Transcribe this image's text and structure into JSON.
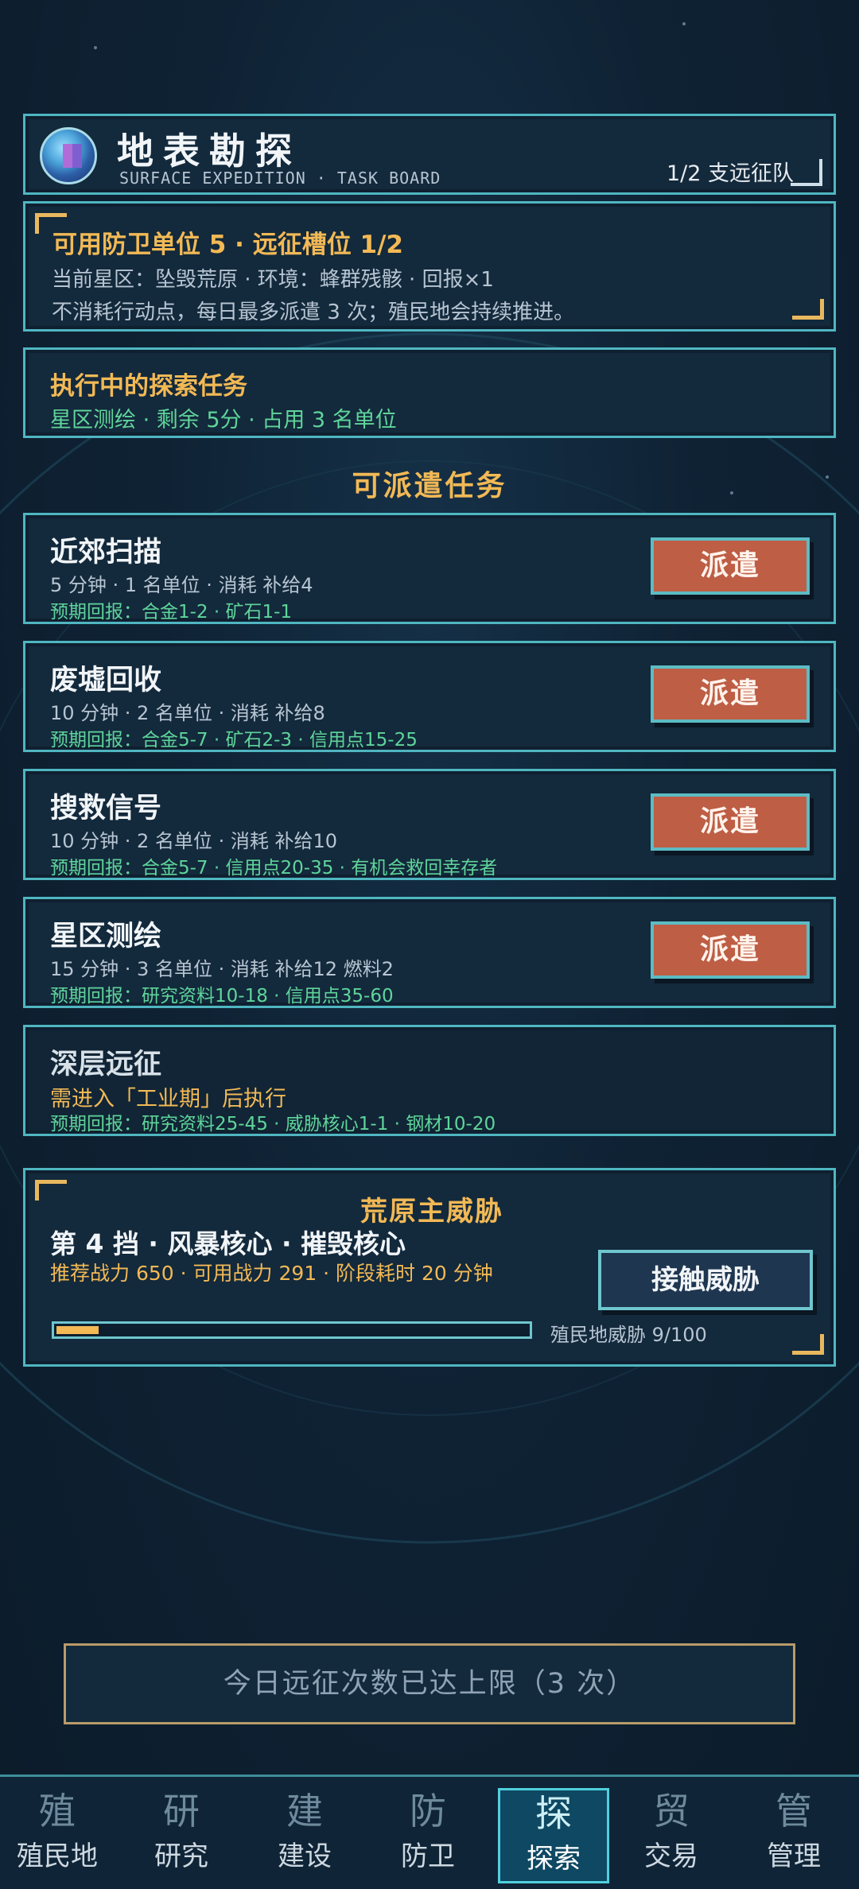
{
  "header": {
    "title": "地表勘探",
    "subtitle": "SURFACE EXPEDITION · TASK BOARD",
    "squad_count": "1/2 支远征队"
  },
  "info": {
    "line1": "可用防卫单位 5 · 远征槽位 1/2",
    "line2": "当前星区：坠毁荒原 · 环境：蜂群残骸 · 回报×1",
    "line3": "不消耗行动点，每日最多派遣 3 次；殖民地会持续推进。"
  },
  "running": {
    "title": "执行中的探索任务",
    "detail": "星区测绘 · 剩余 5分 · 占用 3 名单位"
  },
  "section_title": "可派遣任务",
  "tasks": [
    {
      "name": "近郊扫描",
      "meta": "5 分钟 · 1 名单位 · 消耗 补给4",
      "reward": "预期回报：合金1-2 · 矿石1-1",
      "button": "派遣"
    },
    {
      "name": "废墟回收",
      "meta": "10 分钟 · 2 名单位 · 消耗 补给8",
      "reward": "预期回报：合金5-7 · 矿石2-3 · 信用点15-25",
      "button": "派遣"
    },
    {
      "name": "搜救信号",
      "meta": "10 分钟 · 2 名单位 · 消耗 补给10",
      "reward": "预期回报：合金5-7 · 信用点20-35 · 有机会救回幸存者",
      "button": "派遣"
    },
    {
      "name": "星区测绘",
      "meta": "15 分钟 · 3 名单位 · 消耗 补给12 燃料2",
      "reward": "预期回报：研究资料10-18 · 信用点35-60",
      "button": "派遣"
    },
    {
      "name": "深层远征",
      "requirement": "需进入「工业期」后执行",
      "reward": "预期回报：研究资料25-45 · 威胁核心1-1 · 钢材10-20"
    }
  ],
  "boss": {
    "title": "荒原主威胁",
    "tier": "第 4 挡 · 风暴核心 · 摧毁核心",
    "stats": "推荐战力 650 · 可用战力 291 · 阶段耗时 20 分钟",
    "button": "接触威胁",
    "threat_label": "殖民地威胁 9/100",
    "threat_progress": 0.09
  },
  "limit_banner": "今日远征次数已达上限（3 次）",
  "nav": [
    {
      "icon": "殖",
      "label": "殖民地",
      "active": false
    },
    {
      "icon": "研",
      "label": "研究",
      "active": false
    },
    {
      "icon": "建",
      "label": "建设",
      "active": false
    },
    {
      "icon": "防",
      "label": "防卫",
      "active": false
    },
    {
      "icon": "探",
      "label": "探索",
      "active": true
    },
    {
      "icon": "贸",
      "label": "交易",
      "active": false
    },
    {
      "icon": "管",
      "label": "管理",
      "active": false
    }
  ],
  "colors": {
    "accent": "#4fb6c1",
    "gold": "#f2b955",
    "green": "#5fd59a",
    "dispatch": "#bd5e45"
  }
}
